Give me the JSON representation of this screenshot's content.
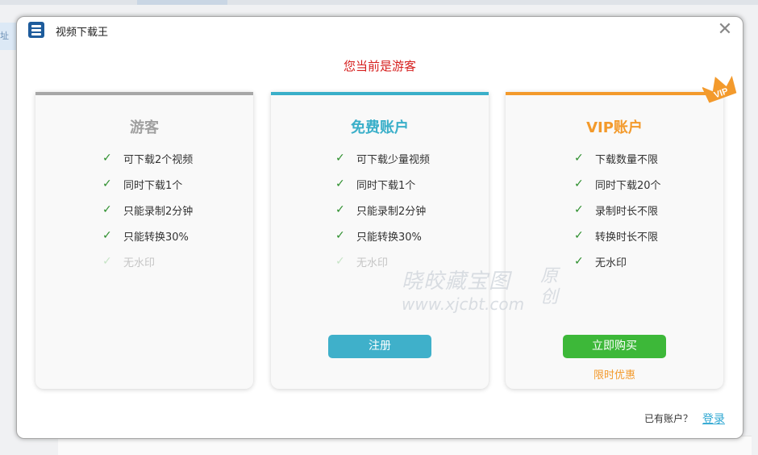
{
  "window": {
    "title": "视频下载王",
    "close_glyph": "✕",
    "icon": "app-logo-icon"
  },
  "status_message": "您当前是游客",
  "plans": [
    {
      "name": "游客",
      "color": "#a0a0a0",
      "features": [
        {
          "text": "可下载2个视频",
          "enabled": true
        },
        {
          "text": "同时下载1个",
          "enabled": true
        },
        {
          "text": "只能录制2分钟",
          "enabled": true
        },
        {
          "text": "只能转换30%",
          "enabled": true
        },
        {
          "text": "无水印",
          "enabled": false
        }
      ]
    },
    {
      "name": "免费账户",
      "color": "#3aafc9",
      "features": [
        {
          "text": "可下载少量视频",
          "enabled": true
        },
        {
          "text": "同时下载1个",
          "enabled": true
        },
        {
          "text": "只能录制2分钟",
          "enabled": true
        },
        {
          "text": "只能转换30%",
          "enabled": true
        },
        {
          "text": "无水印",
          "enabled": false
        }
      ],
      "button_label": "注册",
      "button_color": "#3fb0ca"
    },
    {
      "name": "VIP账户",
      "color": "#f39a2c",
      "badge": "VIP",
      "features": [
        {
          "text": "下载数量不限",
          "enabled": true
        },
        {
          "text": "同时下载20个",
          "enabled": true
        },
        {
          "text": "录制时长不限",
          "enabled": true
        },
        {
          "text": "转换时长不限",
          "enabled": true
        },
        {
          "text": "无水印",
          "enabled": true
        }
      ],
      "button_label": "立即购买",
      "button_color": "#3db839",
      "promo": "限时优惠"
    }
  ],
  "watermark": {
    "line1": "晓皎藏宝图",
    "line2": "www.xjcbt.com",
    "side1": "原",
    "side2": "创"
  },
  "footer": {
    "prompt": "已有账户？",
    "login_label": "登录"
  },
  "background": {
    "left_chip": "址"
  },
  "check_glyph": "✓"
}
